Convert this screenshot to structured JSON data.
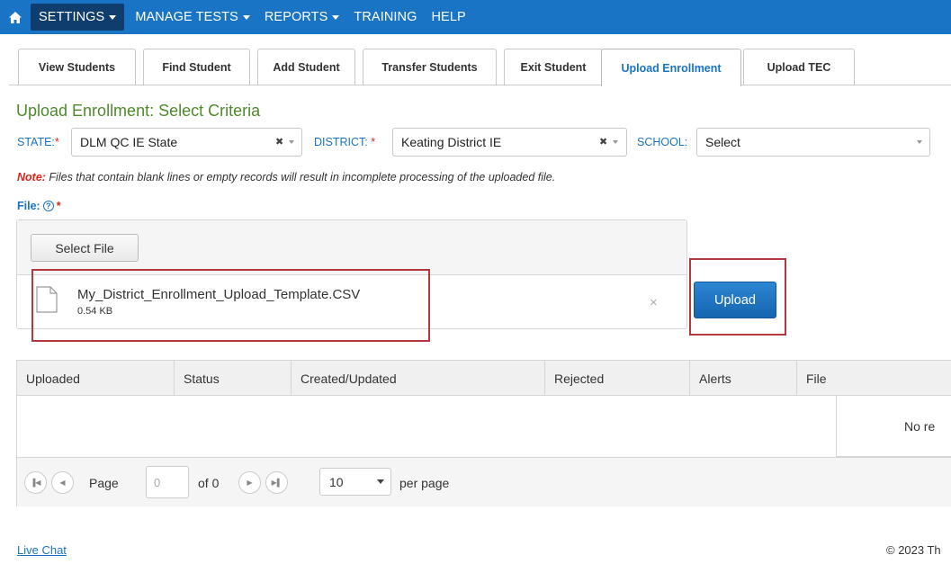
{
  "nav": {
    "items": [
      {
        "label": "SETTINGS",
        "caret": true
      },
      {
        "label": "MANAGE TESTS",
        "caret": true
      },
      {
        "label": "REPORTS",
        "caret": true
      },
      {
        "label": "TRAINING",
        "caret": false
      },
      {
        "label": "HELP",
        "caret": false
      }
    ],
    "active_index": 0
  },
  "tabs": [
    {
      "label": "View Students"
    },
    {
      "label": "Find Student"
    },
    {
      "label": "Add Student"
    },
    {
      "label": "Transfer Students"
    },
    {
      "label": "Exit Student"
    },
    {
      "label": "Upload Enrollment"
    },
    {
      "label": "Upload TEC"
    }
  ],
  "active_tab": "Upload Enrollment",
  "page_title": "Upload Enrollment: Select Criteria",
  "criteria": {
    "state_label": "STATE:",
    "state_value": "DLM QC IE State",
    "district_label": "DISTRICT:",
    "district_value": "Keating District IE",
    "school_label": "SCHOOL:",
    "school_value": "Select",
    "required_mark": "*"
  },
  "note": {
    "prefix": "Note:",
    "text": " Files that contain blank lines or empty records will result in incomplete processing of the uploaded file."
  },
  "file": {
    "label": "File:",
    "help_glyph": "?",
    "required_mark": "*",
    "select_button": "Select File",
    "name": "My_District_Enrollment_Upload_Template.CSV",
    "size": "0.54 KB",
    "remove_glyph": "×"
  },
  "upload_button": "Upload",
  "grid": {
    "columns": [
      "Uploaded",
      "Status",
      "Created/Updated",
      "Rejected",
      "Alerts",
      "File"
    ],
    "empty_text": "No re"
  },
  "pager": {
    "page_label": "Page",
    "page_value": "0",
    "of_text": "of 0",
    "page_size": "10",
    "per_page_text": "per page"
  },
  "footer": {
    "live_chat": "Live Chat",
    "copyright": "© 2023 Th"
  },
  "colors": {
    "nav_bg": "#1a74c6",
    "nav_active_bg": "#0e3d6e",
    "title_green": "#4e8a2c",
    "required_red": "#d9261c",
    "highlight_box": "#b3373b"
  }
}
